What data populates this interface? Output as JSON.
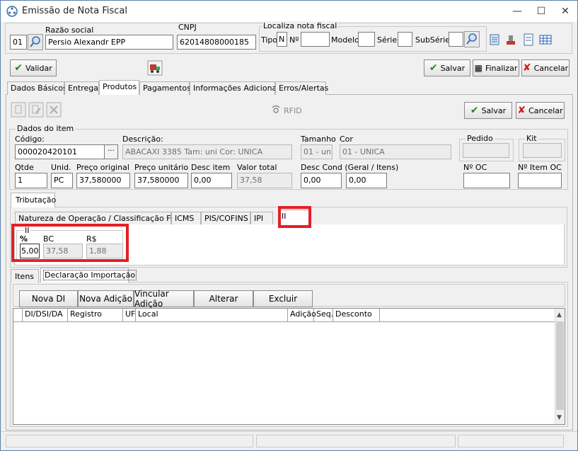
{
  "window": {
    "title": "Emissão de Nota Fiscal",
    "minimize": "—",
    "maximize": "☐",
    "close": "✕"
  },
  "header": {
    "razao_label": "Razão social",
    "cnpj_label": "CNPJ",
    "code_value": "01",
    "razao_value": "Persio Alexandr EPP",
    "cnpj_value": "62014808000185",
    "localiza_label": "Localiza nota fiscal",
    "tipo_label": "Tipo",
    "tipo_value": "N",
    "numero_label": "Nº",
    "modelo_label": "Modelo",
    "serie_label": "Série",
    "subserie_label": "SubSérie"
  },
  "toolbar": {
    "validar": "Validar",
    "salvar": "Salvar",
    "finalizar": "Finalizar",
    "cancelar": "Cancelar"
  },
  "main_tabs": [
    "Dados Básicos",
    "Entrega",
    "Produtos",
    "Pagamentos",
    "Informações Adicionais",
    "Erros/Alertas"
  ],
  "produtos": {
    "rfid": "RFID",
    "salvar": "Salvar",
    "cancelar": "Cancelar",
    "dados_do_item": "Dados do item",
    "codigo_label": "Código:",
    "codigo_value": "000020420101",
    "ellipsis": "···",
    "descricao_label": "Descrição:",
    "descricao_value": "ABACAXI 3385 Tam: uni Cor: UNICA",
    "tamanho_label": "Tamanho",
    "tamanho_value": "01 - uni",
    "cor_label": "Cor",
    "cor_value": "01 - UNICA",
    "pedido_label": "Pedido",
    "kit_label": "Kit",
    "qtde_label": "Qtde",
    "qtde_value": "1",
    "unid_label": "Unid.",
    "unid_value": "PC",
    "preco_original_label": "Preço original",
    "preco_original_value": "37,580000",
    "preco_unitario_label": "Preço unitário",
    "preco_unitario_value": "37,580000",
    "desc_item_label": "Desc item",
    "desc_item_value": "0,00",
    "valor_total_label": "Valor total",
    "valor_total_value": "37,58",
    "desc_cond_label": "Desc Cond (Geral / Itens)",
    "desc_cond_value1": "0,00",
    "desc_cond_value2": "0,00",
    "no_oc_label": "Nº OC",
    "no_item_oc_label": "Nº Item OC"
  },
  "tributacao": {
    "tab": "Tributação",
    "subtabs": [
      "Natureza de Operação / Classificação Fiscal",
      "ICMS",
      "PIS/COFINS",
      "IPI",
      "II"
    ],
    "ii_caption": "II",
    "pct_label": "%",
    "pct_value": "5,00",
    "bc_label": "BC",
    "bc_value": "37,58",
    "rs_label": "R$",
    "rs_value": "1,88"
  },
  "bottom": {
    "tabs": [
      "Itens",
      "Declaração Importação"
    ],
    "buttons": [
      "Nova DI",
      "Nova Adição",
      "Vincular Adição",
      "Alterar",
      "Excluir"
    ],
    "columns": [
      "DI/DSI/DA",
      "Registro",
      "UF",
      "Local",
      "Adição",
      "Seq.",
      "Desconto"
    ]
  },
  "colors": {
    "highlight": "#e41f26",
    "accent": "#3d6fa8"
  }
}
